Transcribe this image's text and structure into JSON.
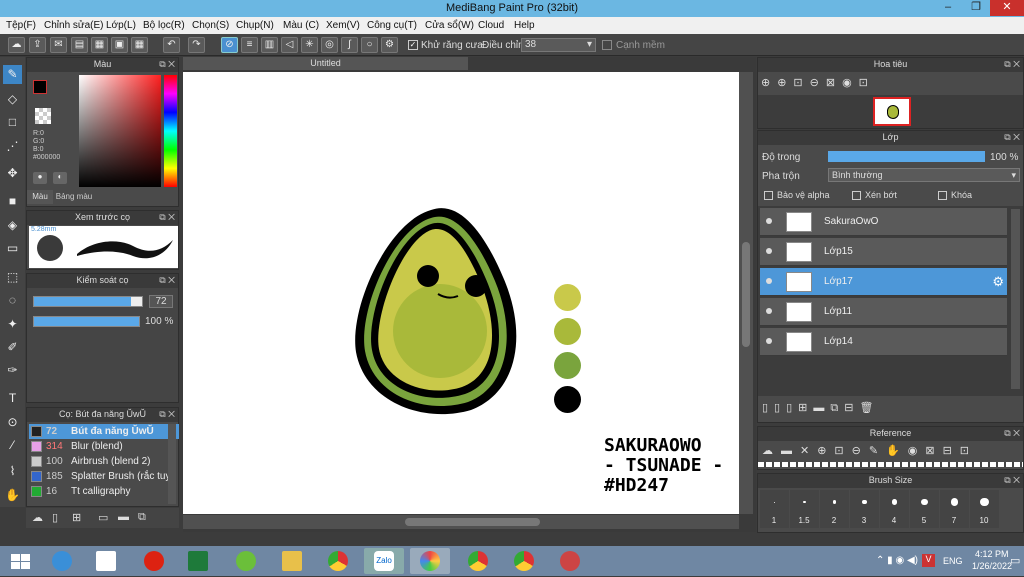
{
  "window": {
    "title": "MediBang Paint Pro (32bit)",
    "minimize": "–",
    "maximize": "❐",
    "close": "✕"
  },
  "menu": [
    "Tệp(F)",
    "Chỉnh sửa(E)",
    "Lớp(L)",
    "Bộ lọc(R)",
    "Chọn(S)",
    "Chụp(N)",
    "Màu (C)",
    "Xem(V)",
    "Công cụ(T)",
    "Cửa sổ(W)",
    "Cloud",
    "Help"
  ],
  "toolbar": {
    "antialias_label": "Khử răng cưa",
    "adjust_label": "Điều chỉnh",
    "adjust_value": "38",
    "snap_label": "Cạnh mềm"
  },
  "color_panel": {
    "title": "Màu",
    "r": "R:0",
    "g": "G:0",
    "b": "B:0",
    "hex": "#000000",
    "tab_color": "Màu",
    "tab_palette": "Bảng màu"
  },
  "brush_preview": {
    "title": "Xem trước cọ",
    "size": "5.28mm"
  },
  "brush_control": {
    "title": "Kiểm soát cọ",
    "size_value": "72",
    "opacity_value": "100 %",
    "size_fraction": 0.9,
    "opacity_fraction": 1.0
  },
  "brush_list": {
    "title": "Cọ: Bút đa năng ŬwŬ",
    "items": [
      {
        "num": "72",
        "name": "Bút đa năng ŬwŬ",
        "color": "#222222",
        "selected": true
      },
      {
        "num": "314",
        "name": "Blur (blend)",
        "color": "#e6a0e6",
        "selected": false
      },
      {
        "num": "100",
        "name": "Airbrush (blend 2)",
        "color": "#cccccc",
        "selected": false
      },
      {
        "num": "185",
        "name": "Splatter Brush (rắc tuyế",
        "color": "#3366cc",
        "selected": false
      },
      {
        "num": "16",
        "name": "Tt calligraphy",
        "color": "#22aa33",
        "selected": false
      }
    ]
  },
  "document": {
    "tab": "Untitled",
    "signature": "SAKURAOWO\n- TSUNADE -\n#HD247"
  },
  "palette_swatches": [
    "#c9c94a",
    "#a9b93a",
    "#7aa43d",
    "#000000"
  ],
  "navigator": {
    "title": "Hoa tiêu"
  },
  "layers": {
    "title": "Lớp",
    "opacity_label": "Độ trong",
    "opacity_value": "100 %",
    "opacity_fraction": 1.0,
    "blend_label": "Pha trộn",
    "blend_value": "Bình thường",
    "protect_alpha": "Bảo vệ alpha",
    "clipping": "Xén bớt",
    "lock": "Khóa",
    "items": [
      {
        "name": "SakuraOwO",
        "selected": false
      },
      {
        "name": "Lớp15",
        "selected": false
      },
      {
        "name": "Lớp17",
        "selected": true
      },
      {
        "name": "Lớp11",
        "selected": false
      },
      {
        "name": "Lớp14",
        "selected": false
      }
    ]
  },
  "reference": {
    "title": "Reference"
  },
  "brush_size": {
    "title": "Brush Size",
    "sizes": [
      "1",
      "1.5",
      "2",
      "3",
      "4",
      "5",
      "7",
      "10"
    ]
  },
  "taskbar": {
    "lang": "ENG",
    "time": "4:12 PM",
    "date": "1/26/2022",
    "zalo": "Zalo"
  }
}
